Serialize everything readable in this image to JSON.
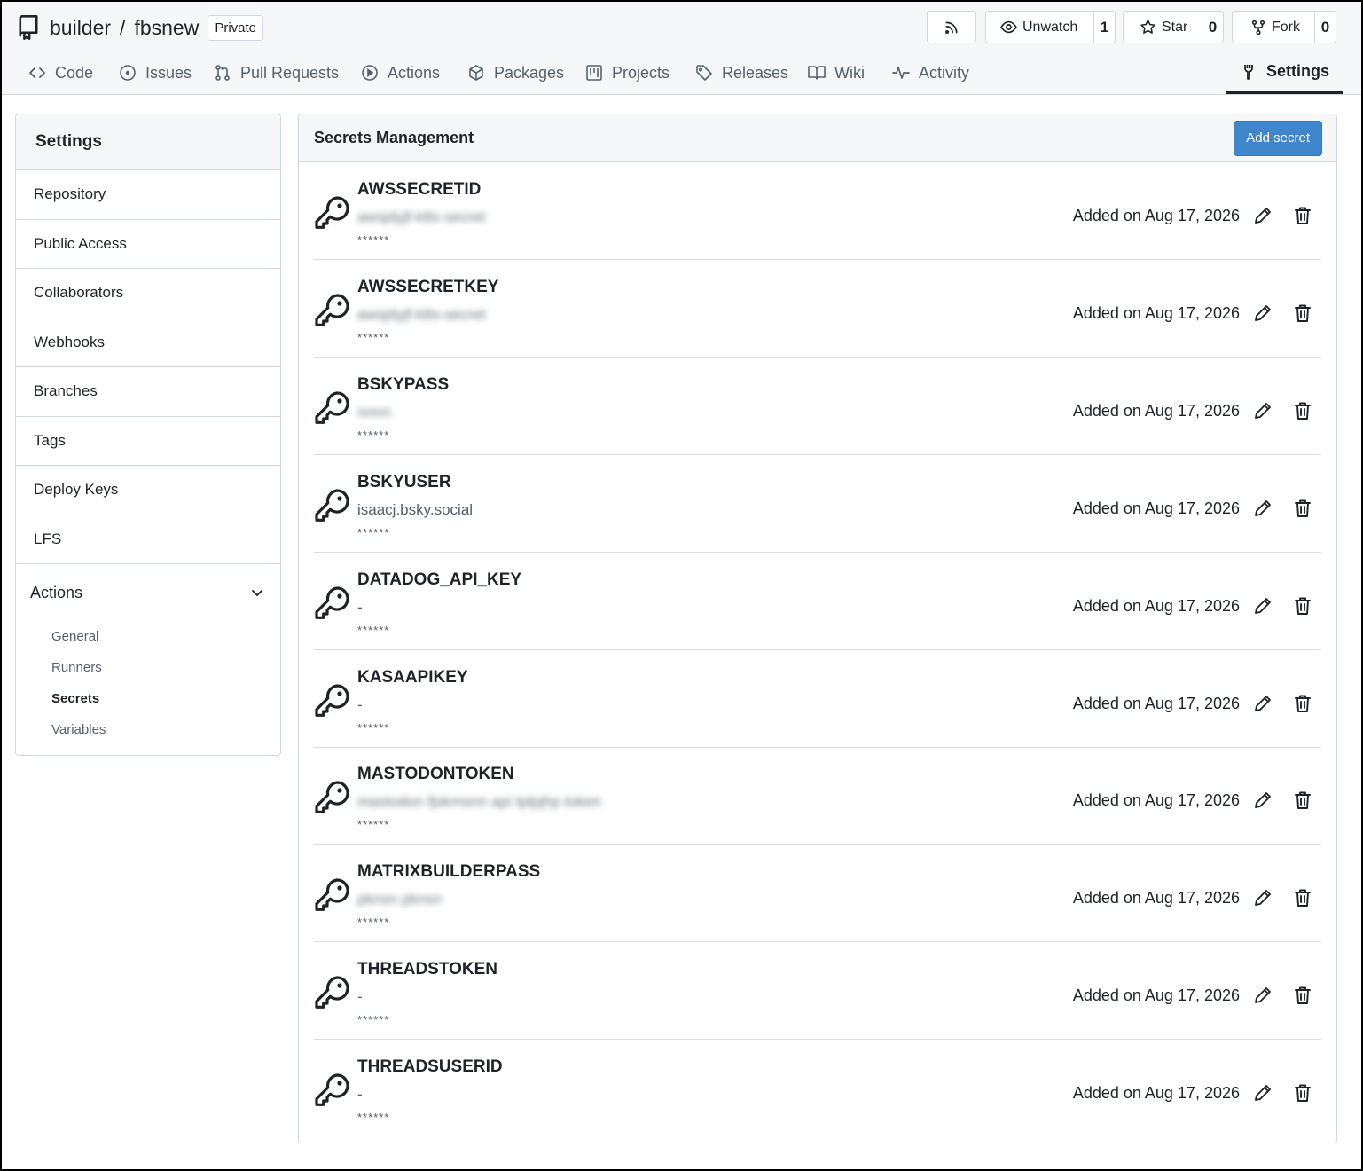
{
  "repo": {
    "owner": "builder",
    "separator": "/",
    "name": "fbsnew",
    "visibility": "Private"
  },
  "header_buttons": {
    "watch": {
      "label": "Unwatch",
      "count": "1"
    },
    "star": {
      "label": "Star",
      "count": "0"
    },
    "fork": {
      "label": "Fork",
      "count": "0"
    }
  },
  "tabs": [
    {
      "label": "Code",
      "icon": "code-icon"
    },
    {
      "label": "Issues",
      "icon": "issue-icon"
    },
    {
      "label": "Pull Requests",
      "icon": "pull-request-icon"
    },
    {
      "label": "Actions",
      "icon": "play-icon"
    },
    {
      "label": "Packages",
      "icon": "package-icon"
    },
    {
      "label": "Projects",
      "icon": "project-icon"
    },
    {
      "label": "Releases",
      "icon": "tag-icon"
    },
    {
      "label": "Wiki",
      "icon": "book-icon"
    },
    {
      "label": "Activity",
      "icon": "pulse-icon"
    },
    {
      "label": "Settings",
      "icon": "tool-icon",
      "active": true
    }
  ],
  "sidebar": {
    "title": "Settings",
    "items": [
      "Repository",
      "Public Access",
      "Collaborators",
      "Webhooks",
      "Branches",
      "Tags",
      "Deploy Keys",
      "LFS"
    ],
    "group": {
      "label": "Actions",
      "sub": [
        "General",
        "Runners",
        "Secrets",
        "Variables"
      ],
      "active": "Secrets"
    }
  },
  "main": {
    "title": "Secrets Management",
    "add_label": "Add secret",
    "secrets": [
      {
        "name": "AWSSECRETID",
        "value": "awsjdyjf-k8s-secret",
        "blur": true,
        "mask": "******",
        "date": "Added on Aug 17, 2026"
      },
      {
        "name": "AWSSECRETKEY",
        "value": "awsjdyjf-k8s-secret",
        "blur": true,
        "mask": "******",
        "date": "Added on Aug 17, 2026"
      },
      {
        "name": "BSKYPASS",
        "value": "nnnn",
        "blur": true,
        "mask": "******",
        "date": "Added on Aug 17, 2026"
      },
      {
        "name": "BSKYUSER",
        "value": "isaacj.bsky.social",
        "blur": false,
        "mask": "******",
        "date": "Added on Aug 17, 2026"
      },
      {
        "name": "DATADOG_API_KEY",
        "value": "-",
        "blur": false,
        "mask": "******",
        "date": "Added on Aug 17, 2026"
      },
      {
        "name": "KASAAPIKEY",
        "value": "-",
        "blur": false,
        "mask": "******",
        "date": "Added on Aug 17, 2026"
      },
      {
        "name": "MASTODONTOKEN",
        "value": "mastodon fjskmsnn api tplpjhp token",
        "blur": true,
        "mask": "******",
        "date": "Added on Aug 17, 2026"
      },
      {
        "name": "MATRIXBUILDERPASS",
        "value": "pknsn pknsn",
        "blur": true,
        "mask": "******",
        "date": "Added on Aug 17, 2026"
      },
      {
        "name": "THREADSTOKEN",
        "value": "-",
        "blur": false,
        "mask": "******",
        "date": "Added on Aug 17, 2026"
      },
      {
        "name": "THREADSUSERID",
        "value": "-",
        "blur": false,
        "mask": "******",
        "date": "Added on Aug 17, 2026"
      }
    ]
  }
}
